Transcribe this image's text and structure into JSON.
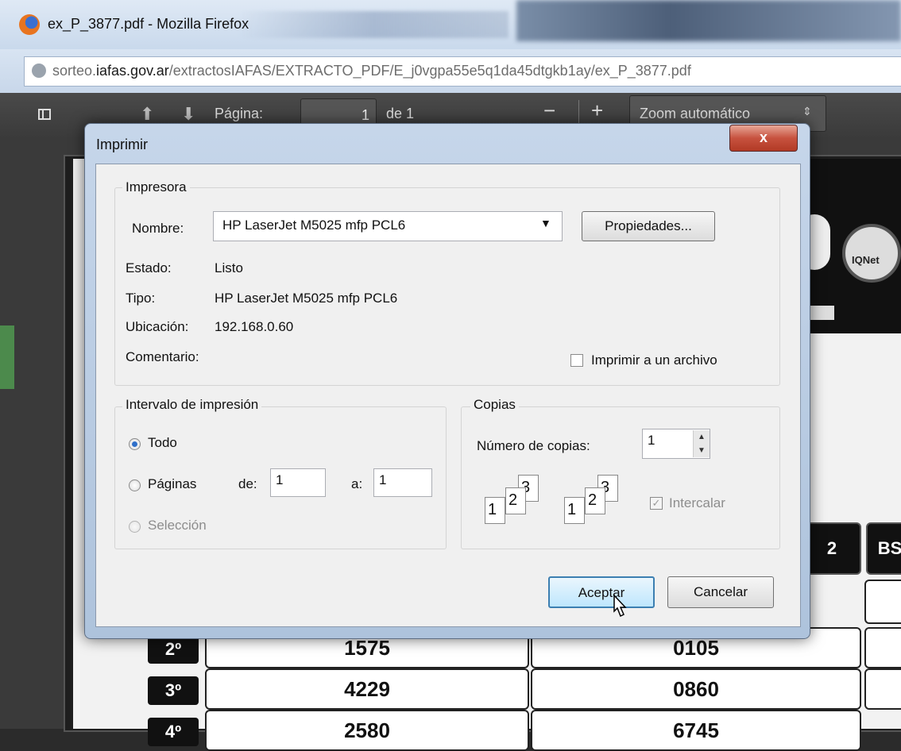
{
  "browser": {
    "window_title": "ex_P_3877.pdf - Mozilla Firefox",
    "url_prefix": "sorteo.",
    "url_domain": "iafas.gov.ar",
    "url_path": "/extractosIAFAS/EXTRACTO_PDF/E_j0vgpa55e5q1da45dtgkb1ay/ex_P_3877.pdf"
  },
  "pdf_toolbar": {
    "page_label": "Página:",
    "page_value": "1",
    "page_of": "de 1",
    "zoom_out": "−",
    "zoom_in": "+",
    "zoom_value": "Zoom automático"
  },
  "document": {
    "logo_text": "IQNet",
    "header_cols": [
      "2",
      "BS"
    ],
    "rows": [
      {
        "ordinal": "2º",
        "a": "1575",
        "b": "0105"
      },
      {
        "ordinal": "3º",
        "a": "4229",
        "b": "0860"
      },
      {
        "ordinal": "4º",
        "a": "2580",
        "b": "6745"
      }
    ]
  },
  "dialog": {
    "title": "Imprimir",
    "close": "x",
    "printer_group": "Impresora",
    "name_label": "Nombre:",
    "printer_name": "HP LaserJet M5025 mfp PCL6",
    "properties_button": "Propiedades...",
    "status_label": "Estado:",
    "status_value": "Listo",
    "type_label": "Tipo:",
    "type_value": "HP LaserJet M5025 mfp PCL6",
    "location_label": "Ubicación:",
    "location_value": "192.168.0.60",
    "comment_label": "Comentario:",
    "print_to_file": "Imprimir a un archivo",
    "range_group": "Intervalo de impresión",
    "all_label": "Todo",
    "pages_label": "Páginas",
    "from_label": "de:",
    "from_value": "1",
    "to_label": "a:",
    "to_value": "1",
    "selection_label": "Selección",
    "copies_group": "Copias",
    "copies_label": "Número de copias:",
    "copies_value": "1",
    "collate_label": "Intercalar",
    "ok_button": "Aceptar",
    "cancel_button": "Cancelar"
  }
}
